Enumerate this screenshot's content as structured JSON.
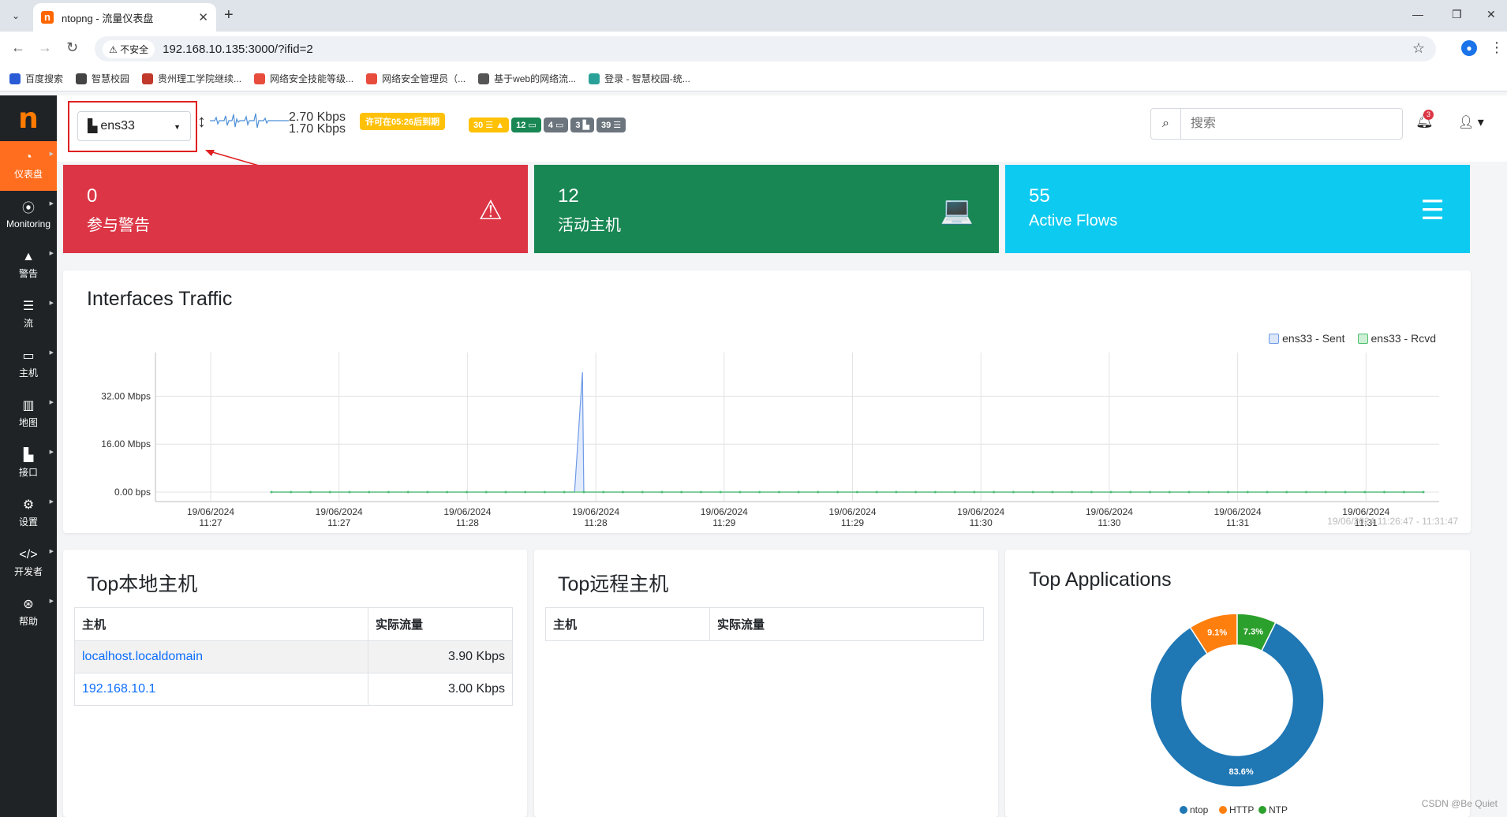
{
  "browser": {
    "tab_title": "ntopng - 流量仪表盘",
    "insecure_label": "不安全",
    "url": "192.168.10.135:3000/?ifid=2",
    "bookmarks": [
      {
        "label": "百度搜索",
        "color": "#2b5cd6"
      },
      {
        "label": "智慧校园",
        "color": "#444444"
      },
      {
        "label": "贵州理工学院继续...",
        "color": "#c0392b"
      },
      {
        "label": "网络安全技能等级...",
        "color": "#e74c3c"
      },
      {
        "label": "网络安全管理员（...",
        "color": "#e74c3c"
      },
      {
        "label": "基于web的网络流...",
        "color": "#555555"
      },
      {
        "label": "登录 - 智慧校园-统...",
        "color": "#2aa198"
      }
    ]
  },
  "sidebar": {
    "logo": "n",
    "items": [
      {
        "label": "仪表盘",
        "icon": "speedometer-icon",
        "glyph": "◔"
      },
      {
        "label": "Monitoring",
        "icon": "monitoring-icon",
        "glyph": "⦿"
      },
      {
        "label": "警告",
        "icon": "warning-icon",
        "glyph": "▲"
      },
      {
        "label": "流",
        "icon": "list-icon",
        "glyph": "☰"
      },
      {
        "label": "主机",
        "icon": "laptop-icon",
        "glyph": "▭"
      },
      {
        "label": "地图",
        "icon": "map-icon",
        "glyph": "▥"
      },
      {
        "label": "接口",
        "icon": "ethernet-icon",
        "glyph": "▙"
      },
      {
        "label": "设置",
        "icon": "gear-icon",
        "glyph": "⚙"
      },
      {
        "label": "开发者",
        "icon": "code-icon",
        "glyph": "</>"
      },
      {
        "label": "帮助",
        "icon": "lifebuoy-icon",
        "glyph": "⊛"
      }
    ]
  },
  "topbar": {
    "interface": "ens33",
    "rate_up": "2.70 Kbps",
    "rate_down": "1.70 Kbps",
    "license": "许可在05:26后到期",
    "badges": [
      {
        "text": "30 ☰ ▲",
        "color": "#ffc107"
      },
      {
        "text": "12 ▭",
        "color": "#198754"
      },
      {
        "text": "4 ▭",
        "color": "#6c757d"
      },
      {
        "text": "3 ▙",
        "color": "#6c757d"
      },
      {
        "text": "39 ☰",
        "color": "#6c757d"
      }
    ],
    "search_placeholder": "搜索",
    "notifications": "3"
  },
  "stats": [
    {
      "value": "0",
      "label": "参与警告",
      "icon": "warning-icon",
      "glyph": "⚠",
      "color": "#dc3545"
    },
    {
      "value": "12",
      "label": "活动主机",
      "icon": "laptop-icon",
      "glyph": "💻",
      "color": "#198754"
    },
    {
      "value": "55",
      "label": "Active Flows",
      "icon": "flows-icon",
      "glyph": "☰",
      "color": "#0dcaf0"
    }
  ],
  "traffic": {
    "title": "Interfaces Traffic",
    "range_label": "19/06/2024 11:26:47 - 11:31:47",
    "chart_data": {
      "type": "area",
      "title": "Interfaces Traffic",
      "y_ticks": [
        "0.00 bps",
        "16.00 Mbps",
        "32.00 Mbps"
      ],
      "ylim": [
        0,
        45
      ],
      "y_unit": "Mbps",
      "x_ticks": [
        [
          "19/06/2024",
          "11:27"
        ],
        [
          "19/06/2024",
          "11:27"
        ],
        [
          "19/06/2024",
          "11:28"
        ],
        [
          "19/06/2024",
          "11:28"
        ],
        [
          "19/06/2024",
          "11:29"
        ],
        [
          "19/06/2024",
          "11:29"
        ],
        [
          "19/06/2024",
          "11:30"
        ],
        [
          "19/06/2024",
          "11:30"
        ],
        [
          "19/06/2024",
          "11:31"
        ],
        [
          "19/06/2024",
          "11:31"
        ]
      ],
      "series": [
        {
          "name": "ens33 - Sent",
          "color": "#6f9be8",
          "fill": "#dbe6fb",
          "spike_at": 0.27,
          "values_mbps": [
            0,
            0,
            0,
            0,
            0,
            0,
            0,
            0,
            0,
            0,
            0,
            0,
            0,
            0,
            0,
            0,
            0,
            0,
            0,
            0,
            0,
            0,
            0,
            0,
            0,
            0,
            0,
            0,
            0,
            0,
            0,
            0,
            0,
            0,
            0,
            0,
            0,
            0,
            0,
            0,
            0,
            0,
            0,
            0,
            0,
            0,
            0,
            0,
            0,
            0,
            0,
            0,
            0,
            0,
            0,
            0,
            0,
            0,
            0,
            0
          ]
        },
        {
          "name": "ens33 - Rcvd",
          "color": "#4cc06b",
          "fill": "#cdefd6",
          "values_mbps": [
            0,
            0,
            0,
            0,
            0,
            0,
            0,
            0,
            0,
            0,
            0,
            0,
            0,
            0,
            0,
            0,
            0,
            0,
            0,
            0,
            0,
            0,
            0,
            0,
            0,
            0,
            0,
            0,
            0,
            0,
            0,
            0,
            0,
            0,
            0,
            0,
            0,
            0,
            0,
            0,
            0,
            0,
            0,
            0,
            0,
            0,
            0,
            0,
            0,
            0,
            0,
            0,
            0,
            0,
            0,
            0,
            0,
            0,
            0,
            0
          ]
        }
      ],
      "sent_spike_mbps": 40,
      "legend": "top-right",
      "grid": true
    }
  },
  "local_hosts": {
    "title": "Top本地主机",
    "headers": [
      "主机",
      "实际流量"
    ],
    "rows": [
      {
        "host": "localhost.localdomain",
        "traffic": "3.90 Kbps"
      },
      {
        "host": "192.168.10.1",
        "traffic": "3.00 Kbps"
      }
    ]
  },
  "remote_hosts": {
    "title": "Top远程主机",
    "headers": [
      "主机",
      "实际流量"
    ]
  },
  "apps": {
    "title": "Top Applications",
    "chart_data": {
      "type": "pie",
      "slices": [
        {
          "name": "ntop",
          "value": 83.6,
          "label": "83.6%",
          "color": "#1f77b4"
        },
        {
          "name": "HTTP",
          "value": 9.1,
          "label": "9.1%",
          "color": "#ff7f0e"
        },
        {
          "name": "NTP",
          "value": 7.3,
          "label": "7.3%",
          "color": "#2ca02c"
        }
      ],
      "legend": "bottom"
    }
  },
  "watermark": "CSDN @Be Quiet"
}
